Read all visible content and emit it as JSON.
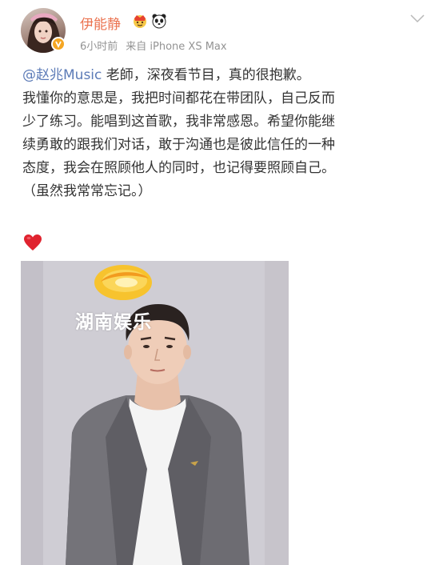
{
  "post": {
    "username": "伊能静",
    "badges": [
      "crown-emoji",
      "panda-emoji"
    ],
    "time": "6小时前",
    "source": "来自 iPhone XS Max",
    "mention": "@赵兆Music",
    "lines": [
      " 老師，深夜看节目，真的很抱歉。",
      "我懂你的意思是，我把时间都花在带团队，自己反而",
      "少了练习。能唱到这首歌，我非常感恩。希望你能继",
      "续勇敢的跟我们对话，敢于沟通也是彼此信任的一种",
      "态度，我会在照顾他人的同时，也记得要照顾自己。",
      "（虽然我常常忘记。）"
    ],
    "emoji": "red-heart"
  },
  "image": {
    "watermark": "湖南娱乐"
  },
  "colors": {
    "username": "#eb7350",
    "mention": "#5c7bb7",
    "text": "#333333",
    "meta": "#939393"
  }
}
